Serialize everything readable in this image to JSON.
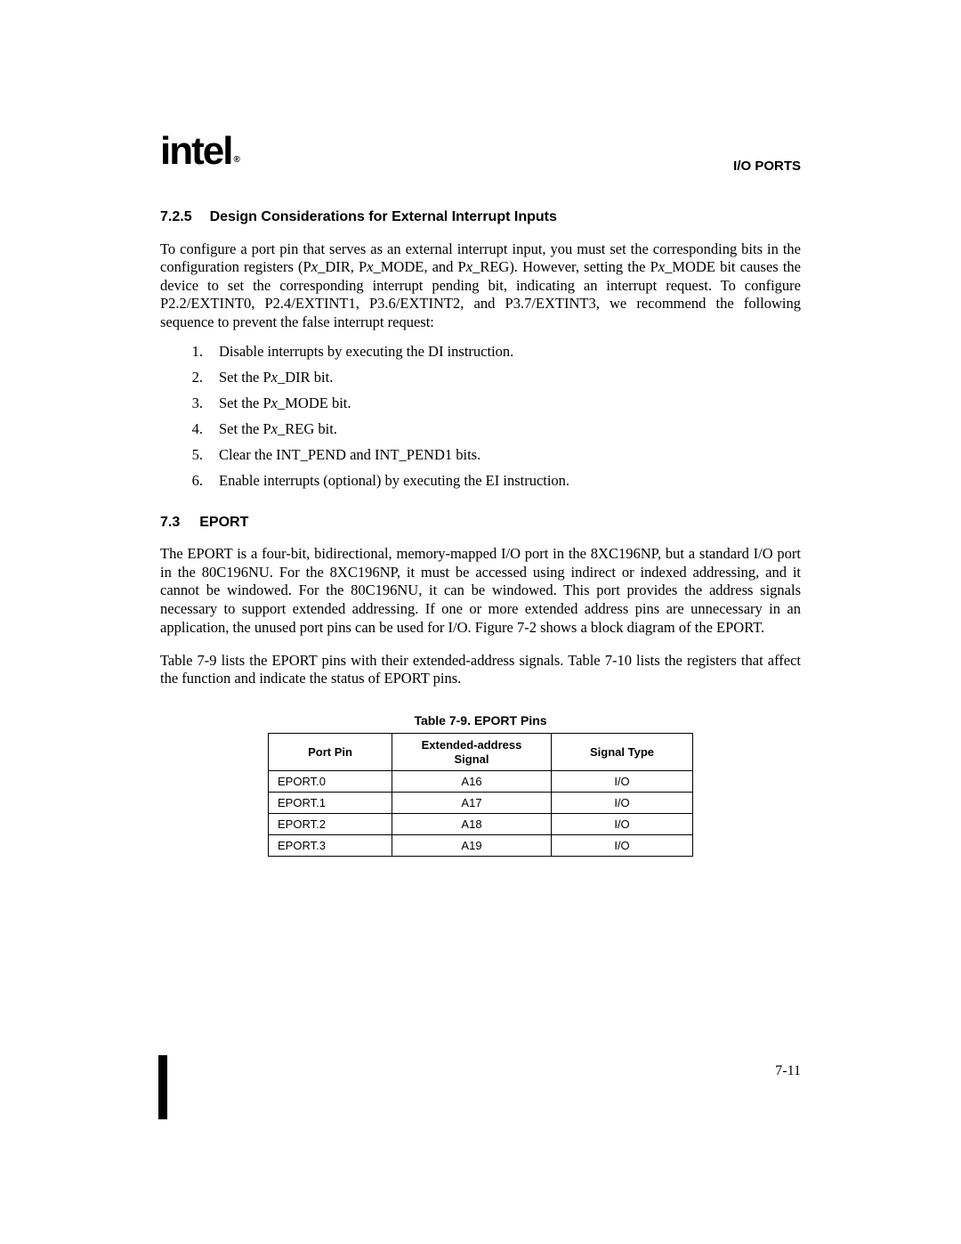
{
  "header": {
    "logo_text": "intel",
    "trademark": "®",
    "title": "I/O PORTS"
  },
  "section1": {
    "number": "7.2.5",
    "title": "Design Considerations for External Interrupt Inputs",
    "paragraph_part1": "To configure a port pin that serves as an external interrupt input, you must set the corresponding bits in the configuration registers (P",
    "px1": "x",
    "paragraph_part2": "_DIR, P",
    "px2": "x",
    "paragraph_part3": "_MODE, and P",
    "px3": "x",
    "paragraph_part4": "_REG). However, setting the P",
    "px4": "x",
    "paragraph_part5": "_MODE bit causes the device to set the corresponding interrupt pending bit, indicating an interrupt request. To configure P2.2/EXTINT0, P2.4/EXTINT1, P3.6/EXTINT2, and P3.7/EXTINT3, we recommend the following sequence to prevent the false interrupt request:",
    "list": [
      {
        "num": "1.",
        "text_pre": "Disable interrupts by executing the DI instruction.",
        "italic": "",
        "text_post": ""
      },
      {
        "num": "2.",
        "text_pre": "Set the P",
        "italic": "x",
        "text_post": "_DIR bit."
      },
      {
        "num": "3.",
        "text_pre": "Set the P",
        "italic": "x",
        "text_post": "_MODE bit."
      },
      {
        "num": "4.",
        "text_pre": "Set the P",
        "italic": "x",
        "text_post": "_REG bit."
      },
      {
        "num": "5.",
        "text_pre": "Clear the INT_PEND and INT_PEND1 bits.",
        "italic": "",
        "text_post": ""
      },
      {
        "num": "6.",
        "text_pre": "Enable interrupts (optional) by executing the EI instruction.",
        "italic": "",
        "text_post": ""
      }
    ]
  },
  "section2": {
    "number": "7.3",
    "title": "EPORT",
    "paragraph1": "The EPORT is a four-bit, bidirectional, memory-mapped I/O port in the 8XC196NP, but a standard I/O port in the 80C196NU. For the 8XC196NP, it must be accessed using indirect or indexed addressing, and it cannot be windowed. For the 80C196NU, it can be windowed. This port provides the address signals necessary to support extended addressing. If one or more extended address pins are unnecessary in an application, the unused port pins can be used for I/O. Figure 7-2 shows a block diagram of the EPORT.",
    "paragraph2": "Table 7-9 lists the EPORT pins with their extended-address signals. Table 7-10 lists the registers that affect the function and indicate the status of EPORT pins."
  },
  "table": {
    "caption": "Table 7-9.  EPORT Pins",
    "headers": [
      "Port Pin",
      "Extended-address\nSignal",
      "Signal Type"
    ],
    "rows": [
      [
        "EPORT.0",
        "A16",
        "I/O"
      ],
      [
        "EPORT.1",
        "A17",
        "I/O"
      ],
      [
        "EPORT.2",
        "A18",
        "I/O"
      ],
      [
        "EPORT.3",
        "A19",
        "I/O"
      ]
    ]
  },
  "footer": {
    "page_number": "7-11"
  }
}
